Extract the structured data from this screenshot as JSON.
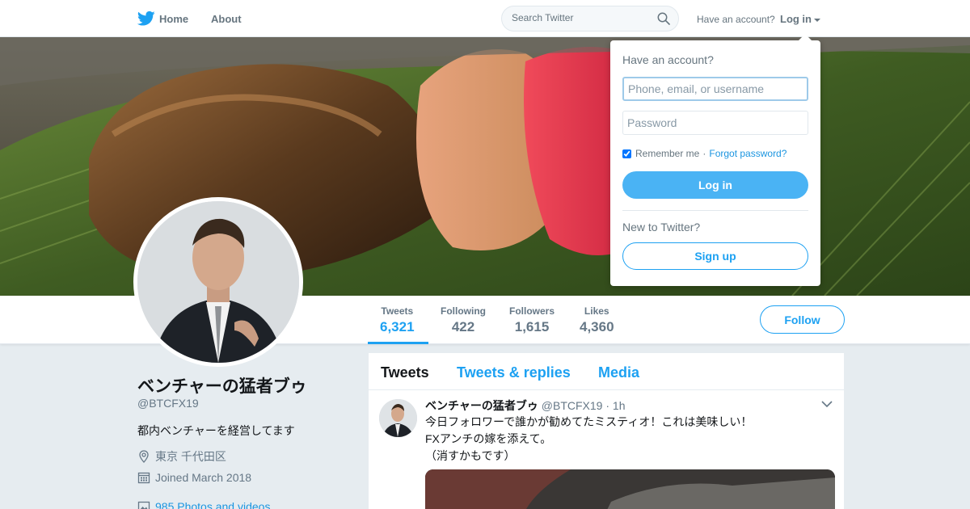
{
  "nav": {
    "home_label": "Home",
    "about_label": "About",
    "search_placeholder": "Search Twitter",
    "have_account": "Have an account?",
    "login_label": "Log in"
  },
  "login_dropdown": {
    "title": "Have an account?",
    "username_placeholder": "Phone, email, or username",
    "password_placeholder": "Password",
    "remember_me": "Remember me",
    "separator": "·",
    "forgot_password": "Forgot password?",
    "login_button": "Log in",
    "new_to_twitter": "New to Twitter?",
    "signup_button": "Sign up"
  },
  "profile_nav": {
    "stats": [
      {
        "label": "Tweets",
        "value": "6,321"
      },
      {
        "label": "Following",
        "value": "422"
      },
      {
        "label": "Followers",
        "value": "1,615"
      },
      {
        "label": "Likes",
        "value": "4,360"
      }
    ],
    "follow_button": "Follow"
  },
  "profile": {
    "name": "ベンチャーの猛者ブゥ",
    "handle": "@BTCFX19",
    "bio": "都内ベンチャーを経営してます",
    "location": "東京 千代田区",
    "joined": "Joined March 2018",
    "photos": "985 Photos and videos"
  },
  "timeline": {
    "tabs": [
      "Tweets",
      "Tweets & replies",
      "Media"
    ],
    "tweet": {
      "name": "ベンチャーの猛者ブゥ",
      "handle": "@BTCFX19",
      "dot": "·",
      "time": "1h",
      "lines": [
        "今日フォロワーで誰かが勧めてたミスティオ！これは美味しい！",
        "FXアンチの嫁を添えて。",
        "（消すかもです）"
      ]
    }
  },
  "colors": {
    "brand": "#1da1f2",
    "background": "#e6ecf0",
    "muted_text": "#657786"
  },
  "icons": [
    "twitter-bird-icon",
    "search-icon",
    "location-pin-icon",
    "calendar-icon",
    "photo-icon",
    "chevron-down-icon"
  ]
}
